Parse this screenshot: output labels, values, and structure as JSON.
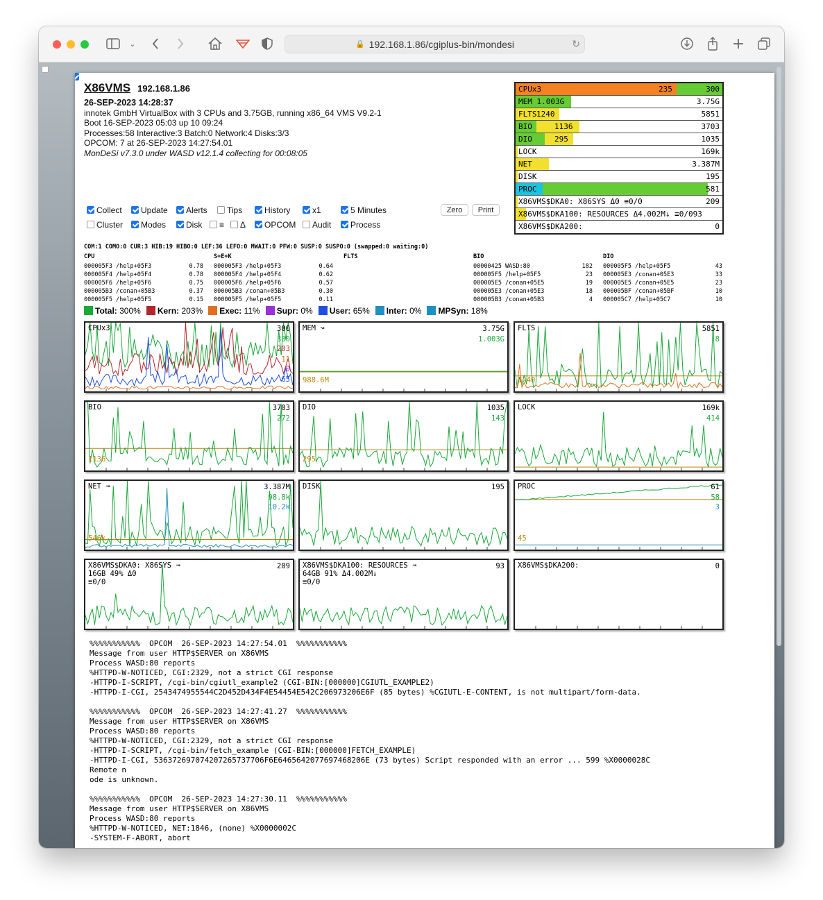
{
  "browser": {
    "url": "192.168.1.86/cgiplus-bin/mondesi"
  },
  "header": {
    "hostname": "X86VMS",
    "ip": "192.168.1.86",
    "datetime": "26-SEP-2023 14:28:37",
    "platform": "innotek GmbH VirtualBox with 3 CPUs and 3.75GB, running x86_64 VMS V9.2-1",
    "boot": "Boot 16-SEP-2023 05:03 up 10 09:24",
    "processes": "Processes:58 Interactive:3 Batch:0 Network:4  Disks:3/3",
    "opcom": "OPCOM: 7 at 26-SEP-2023 14:27:54.01",
    "mondesi": "MonDeSi v7.3.0 under WASD v12.1.4 collecting for 00:08:05"
  },
  "controls": {
    "row1": [
      {
        "label": "Collect",
        "checked": true
      },
      {
        "label": "Update",
        "checked": true
      },
      {
        "label": "Alerts",
        "checked": true
      },
      {
        "label": "Tips",
        "checked": false
      },
      {
        "label": "History",
        "checked": true
      },
      {
        "label": "x1",
        "checked": true
      },
      {
        "label": "5 Minutes",
        "checked": true
      }
    ],
    "row2": [
      {
        "label": "Cluster",
        "checked": false
      },
      {
        "label": "Modes",
        "checked": true
      },
      {
        "label": "Disk",
        "checked": true
      },
      {
        "label": "≡",
        "checked": false
      },
      {
        "label": "Δ",
        "checked": false
      },
      {
        "label": "OPCOM",
        "checked": true
      },
      {
        "label": "Audit",
        "checked": false
      },
      {
        "label": "Process",
        "checked": true
      }
    ],
    "zero_label": "Zero",
    "print_label": "Print"
  },
  "bars": [
    {
      "label": "CPUx3",
      "mid": "235",
      "value": "300",
      "colors": [
        "#f58220",
        "#66cc33"
      ],
      "fill": 0.78,
      "fill2": 0.22
    },
    {
      "label": "MEM 1.003G",
      "mid": "",
      "value": "3.75G",
      "colors": [
        "#66cc33"
      ],
      "fill": 0.27
    },
    {
      "label": "FLTS",
      "mid": "1240",
      "value": "5851",
      "colors": [
        "#f2e030"
      ],
      "fill": 0.21
    },
    {
      "label": "BIO",
      "mid": "1136",
      "value": "3703",
      "colors": [
        "#66cc33",
        "#f2e030"
      ],
      "fill": 0.1,
      "fill2": 0.21
    },
    {
      "label": "DIO",
      "mid": "295",
      "value": "1035",
      "colors": [
        "#66cc33",
        "#f2e030"
      ],
      "fill": 0.14,
      "fill2": 0.14
    },
    {
      "label": "LOCK",
      "mid": "",
      "value": "169k",
      "colors": [
        "#f2e030"
      ],
      "fill": 0.01
    },
    {
      "label": "NET",
      "mid": "",
      "value": "3.387M",
      "colors": [
        "#f2e030"
      ],
      "fill": 0.16
    },
    {
      "label": "DISK",
      "mid": "",
      "value": "195",
      "colors": [
        "#f2e030"
      ],
      "fill": 0.01
    },
    {
      "label": "PROC",
      "mid": "",
      "value": "58",
      "suffix": "61",
      "colors": [
        "#18c4e0",
        "#66cc33"
      ],
      "fill": 0.13,
      "fill2": 0.8
    },
    {
      "label": "X86VMS$DKA0: X86SYS Δ0 ≡0/0",
      "mid": "",
      "value": "209",
      "colors": [
        "#f2e030"
      ],
      "fill": 0.01
    },
    {
      "label": "X86VMS$DKA100: RESOURCES Δ4.002M↓ ≡0/093",
      "mid": "",
      "value": "",
      "colors": [
        "#f2e030"
      ],
      "fill": 0.05
    },
    {
      "label": "X86VMS$DKA200:",
      "mid": "",
      "value": "0",
      "colors": [
        "#f2e030"
      ],
      "fill": 0.0
    }
  ],
  "stats": {
    "summary": "COM:1 COMO:0 CUR:3 HIB:19 HIBO:0 LEF:36 LEFO:0 MWAIT:0 PFW:0 SUSP:0 SUSPO:0 (swapped:0 waiting:0)",
    "headers": [
      "CPU",
      "S+E+K",
      "FLTS",
      "BIO",
      "DIO"
    ],
    "cpu": [
      [
        "000005F3 /help+05F3",
        "0.78"
      ],
      [
        "000005F4 /help+05F4",
        "0.78"
      ],
      [
        "000005F6 /help+05F6",
        "0.75"
      ],
      [
        "000005B3 /conan+05B3",
        "0.37"
      ],
      [
        "000005F5 /help+05F5",
        "0.15"
      ]
    ],
    "sek": [
      [
        "000005F3 /help+05F3",
        "0.64"
      ],
      [
        "000005F4 /help+05F4",
        "0.62"
      ],
      [
        "000005F6 /help+05F6",
        "0.57"
      ],
      [
        "000005B3 /conan+05B3",
        "0.30"
      ],
      [
        "000005F5 /help+05F5",
        "0.11"
      ]
    ],
    "bio": [
      [
        "00000425 WASD:80",
        "182"
      ],
      [
        "000005F5 /help+05F5",
        "23"
      ],
      [
        "000005E5 /conan+05E5",
        "19"
      ],
      [
        "000005E3 /conan+05E3",
        "18"
      ],
      [
        "000005B3 /conan+05B3",
        "4"
      ]
    ],
    "dio": [
      [
        "000005F5 /help+05F5",
        "43"
      ],
      [
        "000005E3 /conan+05E3",
        "33"
      ],
      [
        "000005E5 /conan+05E5",
        "23"
      ],
      [
        "000005BF /conan+05BF",
        "10"
      ],
      [
        "000005C7 /help+05C7",
        "10"
      ]
    ]
  },
  "legend": [
    {
      "label": "Total:",
      "value": "300%",
      "color": "#1aa83a"
    },
    {
      "label": "Kern:",
      "value": "203%",
      "color": "#b3282d"
    },
    {
      "label": "Exec:",
      "value": "11%",
      "color": "#e07020"
    },
    {
      "label": "Supr:",
      "value": "0%",
      "color": "#9b30d9"
    },
    {
      "label": "User:",
      "value": "65%",
      "color": "#1f4fe0"
    },
    {
      "label": "Inter:",
      "value": "0%",
      "color": "#2090c0"
    },
    {
      "label": "MPSyn:",
      "value": "18%",
      "color": "#1a90c8"
    }
  ],
  "graphs": [
    {
      "title": "CPUx3",
      "vals": [
        "300",
        "300",
        "203",
        "11",
        "0",
        "65"
      ],
      "valcolors": [
        "#000",
        "#1aa83a",
        "#b3282d",
        "#e07020",
        "#9b30d9",
        "#1f4fe0"
      ],
      "base": ""
    },
    {
      "title": "MEM ↝",
      "vals": [
        "3.75G",
        "1.003G"
      ],
      "valcolors": [
        "#000",
        "#1aa83a"
      ],
      "base": "988.6M"
    },
    {
      "title": "FLTS",
      "vals": [
        "5851",
        "8"
      ],
      "valcolors": [
        "#000",
        "#1aa83a"
      ],
      "base": "1240"
    },
    {
      "title": "BIO",
      "vals": [
        "3703",
        "272"
      ],
      "valcolors": [
        "#000",
        "#1aa83a"
      ],
      "base": "1136"
    },
    {
      "title": "DIO",
      "vals": [
        "1035",
        "143"
      ],
      "valcolors": [
        "#000",
        "#1aa83a"
      ],
      "base": "295"
    },
    {
      "title": "LOCK",
      "vals": [
        "169k",
        "414"
      ],
      "valcolors": [
        "#000",
        "#1aa83a"
      ],
      "base": ""
    },
    {
      "title": "NET ↝",
      "vals": [
        "3.387M",
        "98.8k",
        "10.2k"
      ],
      "valcolors": [
        "#000",
        "#1aa83a",
        "#2090c0"
      ],
      "base": "546k"
    },
    {
      "title": "DISK",
      "vals": [
        "195"
      ],
      "valcolors": [
        "#000"
      ],
      "base": ""
    },
    {
      "title": "PROC",
      "vals": [
        "61",
        "58",
        "3"
      ],
      "valcolors": [
        "#000",
        "#1aa83a",
        "#2090c0"
      ],
      "base": "45"
    },
    {
      "title": "X86VMS$DKA0: X86SYS ↝\n16GB 49% Δ0\n≡0/0",
      "vals": [
        "209"
      ],
      "valcolors": [
        "#000"
      ],
      "base": ""
    },
    {
      "title": "X86VMS$DKA100: RESOURCES ↝\n64GB 91% Δ4.002M↓\n≡0/0",
      "vals": [
        "93"
      ],
      "valcolors": [
        "#000"
      ],
      "base": ""
    },
    {
      "title": "X86VMS$DKA200:",
      "vals": [
        "0"
      ],
      "valcolors": [
        "#000"
      ],
      "base": ""
    }
  ],
  "opcom_text": "%%%%%%%%%%%  OPCOM  26-SEP-2023 14:27:54.01  %%%%%%%%%%%\nMessage from user HTTP$SERVER on X86VMS\nProcess WASD:80 reports\n%HTTPD-W-NOTICED, CGI:2329, not a strict CGI response\n-HTTPD-I-SCRIPT, /cgi-bin/cgiutl_example2 (CGI-BIN:[000000]CGIUTL_EXAMPLE2)\n-HTTPD-I-CGI, 2543474955544C2D452D434F4E54454E542C206973206E6F (85 bytes) %CGIUTL-E-CONTENT, is not multipart/form-data.\n\n%%%%%%%%%%%  OPCOM  26-SEP-2023 14:27:41.27  %%%%%%%%%%%\nMessage from user HTTP$SERVER on X86VMS\nProcess WASD:80 reports\n%HTTPD-W-NOTICED, CGI:2329, not a strict CGI response\n-HTTPD-I-SCRIPT, /cgi-bin/fetch_example (CGI-BIN:[000000]FETCH_EXAMPLE)\n-HTTPD-I-CGI, 536372697074207265737706F6E6465642077697468206E (73 bytes) Script responded with an error ... 599 %X0000028C\nRemote n\node is unknown.\n\n%%%%%%%%%%%  OPCOM  26-SEP-2023 14:27:30.11  %%%%%%%%%%%\nMessage from user HTTP$SERVER on X86VMS\nProcess WASD:80 reports\n%HTTPD-W-NOTICED, NET:1846, (none) %X0000002C\n-SYSTEM-F-ABORT, abort"
}
